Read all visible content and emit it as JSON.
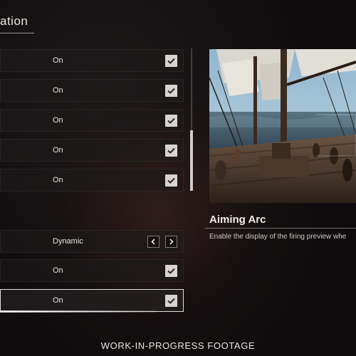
{
  "header": {
    "title": "ation"
  },
  "settings": {
    "rows": [
      {
        "value": "On",
        "control": "checkbox",
        "checked": true
      },
      {
        "value": "On",
        "control": "checkbox",
        "checked": true
      },
      {
        "value": "On",
        "control": "checkbox",
        "checked": true
      },
      {
        "value": "On",
        "control": "checkbox",
        "checked": true
      },
      {
        "value": "On",
        "control": "checkbox",
        "checked": true
      },
      {
        "value": "Dynamic",
        "control": "arrows"
      },
      {
        "value": "On",
        "control": "checkbox",
        "checked": true
      },
      {
        "value": "On",
        "control": "checkbox",
        "checked": true,
        "selected": true
      }
    ]
  },
  "preview": {
    "title": "Aiming Arc",
    "description": "Enable the display of the firing preview whe"
  },
  "footer": {
    "text": "WORK-IN-PROGRESS FOOTAGE"
  },
  "icons": {
    "checkbox": "check-icon",
    "prev": "chevron-left-icon",
    "next": "chevron-right-icon"
  },
  "colors": {
    "background": "#0d0b0c",
    "checkbox_fill": "#d8d5d0",
    "check_mark": "#2a2627",
    "text": "#e6e3df"
  }
}
